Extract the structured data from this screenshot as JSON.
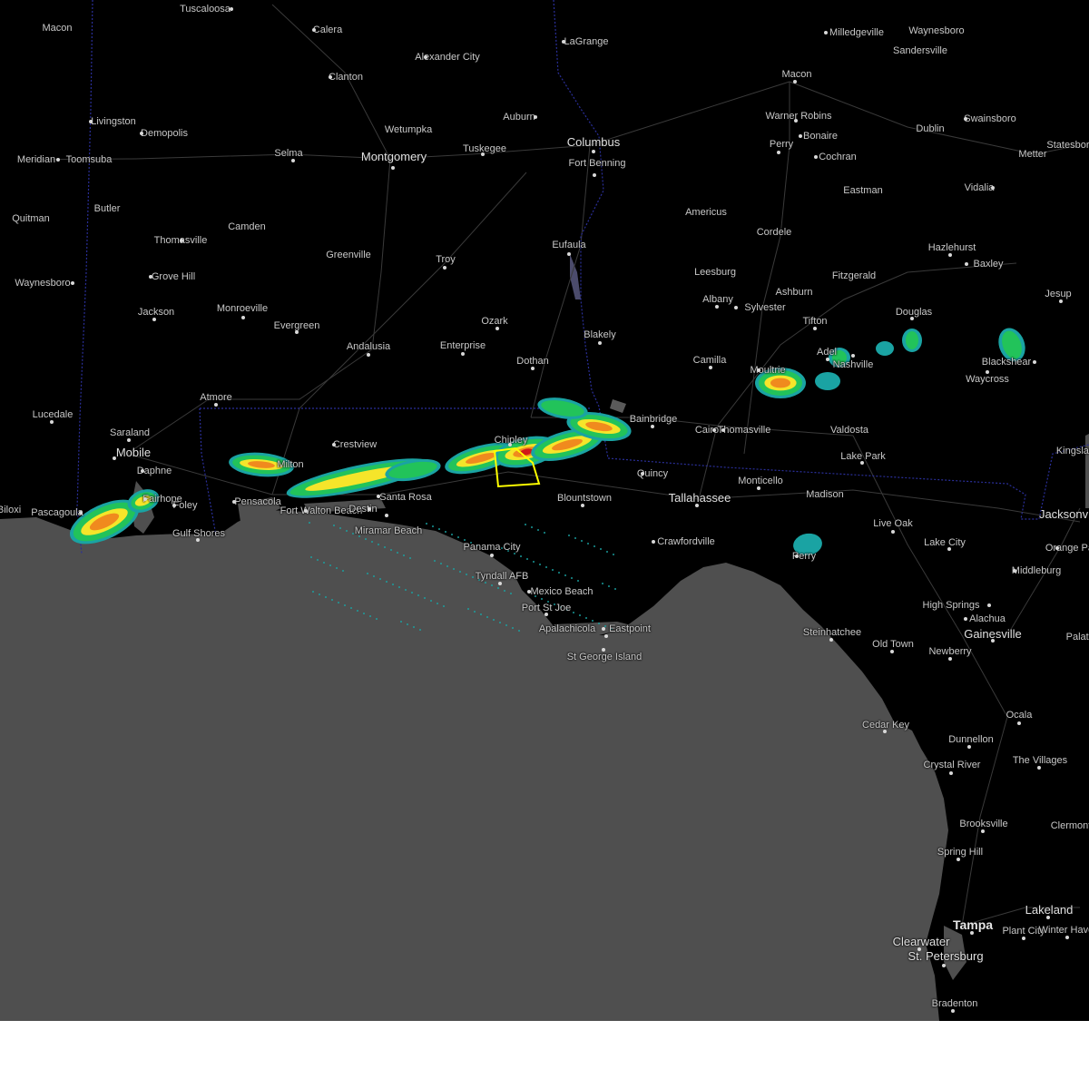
{
  "map": {
    "colors": {
      "land": "#000000",
      "water": "#4f4f4f",
      "roads": "#3a3a3a",
      "state_border": "#2a2f9a",
      "warning_polygon": "#ffff00",
      "radar_light": "#1aa3a3",
      "radar_green": "#22c35a",
      "radar_yellow": "#f5e52a",
      "radar_orange": "#f08a1e",
      "radar_red": "#d01818"
    },
    "cities": [
      {
        "name": "Tuscaloosa",
        "size": "small"
      },
      {
        "name": "Macon",
        "size": "small"
      },
      {
        "name": "Calera",
        "size": "small"
      },
      {
        "name": "LaGrange",
        "size": "small"
      },
      {
        "name": "Milledgeville",
        "size": "small"
      },
      {
        "name": "Waynesboro",
        "size": "small"
      },
      {
        "name": "Alexander City",
        "size": "small"
      },
      {
        "name": "Sandersville",
        "size": "small"
      },
      {
        "name": "Clanton",
        "size": "small"
      },
      {
        "name": "Macon",
        "size": "small"
      },
      {
        "name": "Livingston",
        "size": "small"
      },
      {
        "name": "Wetumpka",
        "size": "small"
      },
      {
        "name": "Auburn",
        "size": "small"
      },
      {
        "name": "Warner Robins",
        "size": "small"
      },
      {
        "name": "Swainsboro",
        "size": "small"
      },
      {
        "name": "Demopolis",
        "size": "small"
      },
      {
        "name": "Dublin",
        "size": "small"
      },
      {
        "name": "Columbus",
        "size": "mid"
      },
      {
        "name": "Bonaire",
        "size": "small"
      },
      {
        "name": "Perry",
        "size": "small"
      },
      {
        "name": "Tuskegee",
        "size": "small"
      },
      {
        "name": "Statesboro",
        "size": "small"
      },
      {
        "name": "Selma",
        "size": "small"
      },
      {
        "name": "Montgomery",
        "size": "mid"
      },
      {
        "name": "Meridian",
        "size": "small"
      },
      {
        "name": "Toomsuba",
        "size": "small"
      },
      {
        "name": "Cochran",
        "size": "small"
      },
      {
        "name": "Metter",
        "size": "small"
      },
      {
        "name": "Fort Benning",
        "size": "small"
      },
      {
        "name": "Eastman",
        "size": "small"
      },
      {
        "name": "Vidalia",
        "size": "small"
      },
      {
        "name": "Butler",
        "size": "small"
      },
      {
        "name": "Americus",
        "size": "small"
      },
      {
        "name": "Quitman",
        "size": "small"
      },
      {
        "name": "Camden",
        "size": "small"
      },
      {
        "name": "Cordele",
        "size": "small"
      },
      {
        "name": "Thomasville",
        "size": "small"
      },
      {
        "name": "Eufaula",
        "size": "small"
      },
      {
        "name": "Hazlehurst",
        "size": "small"
      },
      {
        "name": "Greenville",
        "size": "small"
      },
      {
        "name": "Troy",
        "size": "small"
      },
      {
        "name": "Baxley",
        "size": "small"
      },
      {
        "name": "Leesburg",
        "size": "small"
      },
      {
        "name": "Fitzgerald",
        "size": "small"
      },
      {
        "name": "Grove Hill",
        "size": "small"
      },
      {
        "name": "Waynesboro",
        "size": "small"
      },
      {
        "name": "Ashburn",
        "size": "small"
      },
      {
        "name": "Jesup",
        "size": "small"
      },
      {
        "name": "Albany",
        "size": "small"
      },
      {
        "name": "Monroeville",
        "size": "small"
      },
      {
        "name": "Sylvester",
        "size": "small"
      },
      {
        "name": "Douglas",
        "size": "small"
      },
      {
        "name": "Jackson",
        "size": "small"
      },
      {
        "name": "Ozark",
        "size": "small"
      },
      {
        "name": "Tifton",
        "size": "small"
      },
      {
        "name": "Evergreen",
        "size": "small"
      },
      {
        "name": "Blakely",
        "size": "small"
      },
      {
        "name": "Enterprise",
        "size": "small"
      },
      {
        "name": "Andalusia",
        "size": "small"
      },
      {
        "name": "Blackshear",
        "size": "small"
      },
      {
        "name": "Camilla",
        "size": "small"
      },
      {
        "name": "Nashville",
        "size": "small"
      },
      {
        "name": "Dothan",
        "size": "small"
      },
      {
        "name": "Moultrie",
        "size": "small"
      },
      {
        "name": "Adel",
        "size": "small"
      },
      {
        "name": "Waycross",
        "size": "small"
      },
      {
        "name": "Atmore",
        "size": "small"
      },
      {
        "name": "Bainbridge",
        "size": "small"
      },
      {
        "name": "Lucedale",
        "size": "small"
      },
      {
        "name": "Cairo",
        "size": "small"
      },
      {
        "name": "Thomasville",
        "size": "small"
      },
      {
        "name": "Valdosta",
        "size": "small"
      },
      {
        "name": "Saraland",
        "size": "small"
      },
      {
        "name": "Chipley",
        "size": "small"
      },
      {
        "name": "Crestview",
        "size": "small"
      },
      {
        "name": "Kingsland",
        "size": "small"
      },
      {
        "name": "Mobile",
        "size": "mid"
      },
      {
        "name": "Lake Park",
        "size": "small"
      },
      {
        "name": "Daphne",
        "size": "small"
      },
      {
        "name": "Quincy",
        "size": "small"
      },
      {
        "name": "Monticello",
        "size": "small"
      },
      {
        "name": "Fairhope",
        "size": "small"
      },
      {
        "name": "Milton",
        "size": "small"
      },
      {
        "name": "Madison",
        "size": "small"
      },
      {
        "name": "Pensacola",
        "size": "small"
      },
      {
        "name": "Foley",
        "size": "small"
      },
      {
        "name": "Tallahassee",
        "size": "mid"
      },
      {
        "name": "Blountstown",
        "size": "small"
      },
      {
        "name": "Santa Rosa",
        "size": "small"
      },
      {
        "name": "Fort Walton Beach",
        "size": "small"
      },
      {
        "name": "Destin",
        "size": "small"
      },
      {
        "name": "Pascagoula",
        "size": "small"
      },
      {
        "name": "Biloxi",
        "size": "small"
      },
      {
        "name": "Jacksonville",
        "size": "mid"
      },
      {
        "name": "Live Oak",
        "size": "small"
      },
      {
        "name": "Gulf Shores",
        "size": "small"
      },
      {
        "name": "Miramar Beach",
        "size": "small"
      },
      {
        "name": "Lake City",
        "size": "small"
      },
      {
        "name": "Crawfordville",
        "size": "small"
      },
      {
        "name": "Orange Park",
        "size": "small"
      },
      {
        "name": "Panama City",
        "size": "small"
      },
      {
        "name": "Perry",
        "size": "small"
      },
      {
        "name": "Middleburg",
        "size": "small"
      },
      {
        "name": "Tyndall AFB",
        "size": "small"
      },
      {
        "name": "Mexico Beach",
        "size": "small"
      },
      {
        "name": "High Springs",
        "size": "small"
      },
      {
        "name": "Port St Joe",
        "size": "small"
      },
      {
        "name": "Alachua",
        "size": "small"
      },
      {
        "name": "Apalachicola",
        "size": "small"
      },
      {
        "name": "Eastpoint",
        "size": "small"
      },
      {
        "name": "Steinhatchee",
        "size": "small"
      },
      {
        "name": "Gainesville",
        "size": "mid"
      },
      {
        "name": "Palatka",
        "size": "small"
      },
      {
        "name": "Old Town",
        "size": "small"
      },
      {
        "name": "Newberry",
        "size": "small"
      },
      {
        "name": "St George Island",
        "size": "small"
      },
      {
        "name": "Ocala",
        "size": "small"
      },
      {
        "name": "Cedar Key",
        "size": "small"
      },
      {
        "name": "Dunnellon",
        "size": "small"
      },
      {
        "name": "The Villages",
        "size": "small"
      },
      {
        "name": "Crystal River",
        "size": "small"
      },
      {
        "name": "Brooksville",
        "size": "small"
      },
      {
        "name": "Clermont",
        "size": "small"
      },
      {
        "name": "Spring Hill",
        "size": "small"
      },
      {
        "name": "Lakeland",
        "size": "mid"
      },
      {
        "name": "Tampa",
        "size": "major"
      },
      {
        "name": "Plant City",
        "size": "small"
      },
      {
        "name": "Winter Haven",
        "size": "small"
      },
      {
        "name": "Clearwater",
        "size": "mid"
      },
      {
        "name": "St. Petersburg",
        "size": "mid"
      },
      {
        "name": "Bradenton",
        "size": "small"
      }
    ]
  }
}
